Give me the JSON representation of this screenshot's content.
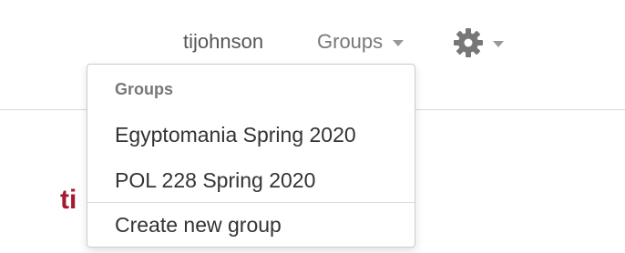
{
  "header": {
    "username": "tijohnson",
    "groups_label": "Groups",
    "settings_icon": "gear-icon"
  },
  "page": {
    "brand_fragment": "ti"
  },
  "groups_dropdown": {
    "header": "Groups",
    "items": [
      {
        "label": "Egyptomania Spring 2020"
      },
      {
        "label": "POL 228 Spring 2020"
      }
    ],
    "create_label": "Create new group"
  },
  "colors": {
    "brand_red": "#a6192e",
    "text_muted": "#777777",
    "text_dark": "#333333"
  }
}
